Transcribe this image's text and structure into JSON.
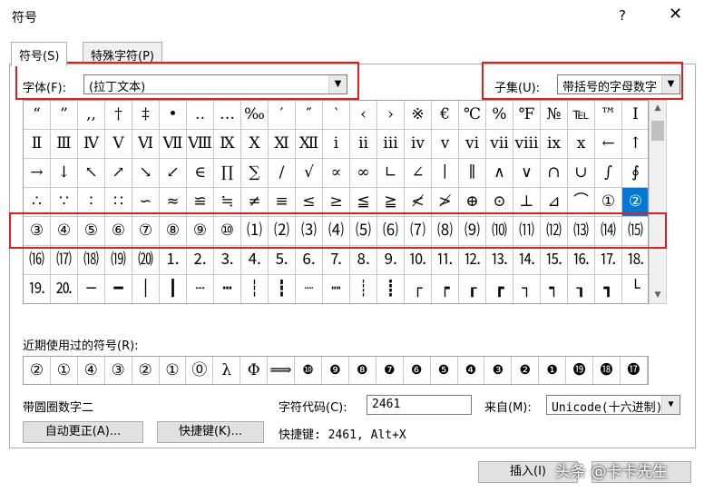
{
  "window": {
    "title": "符号",
    "help": "?",
    "close": "✕"
  },
  "tabs": [
    {
      "label": "符号(S)"
    },
    {
      "label": "特殊字符(P)"
    }
  ],
  "font": {
    "label": "字体(F):",
    "value": "(拉丁文本)"
  },
  "subset": {
    "label": "子集(U):",
    "value": "带括号的字母数字"
  },
  "symbols": [
    "“",
    "”",
    ",,",
    "†",
    "‡",
    "•",
    "‥",
    "…",
    "‰",
    "′",
    "″",
    "‵",
    "‹",
    "›",
    "※",
    "€",
    "℃",
    "%",
    "℉",
    "№",
    "℡",
    "™",
    "Ⅰ",
    "Ⅱ",
    "Ⅲ",
    "Ⅳ",
    "Ⅴ",
    "Ⅵ",
    "Ⅶ",
    "Ⅷ",
    "Ⅸ",
    "Ⅹ",
    "Ⅺ",
    "Ⅻ",
    "ⅰ",
    "ⅱ",
    "ⅲ",
    "ⅳ",
    "ⅴ",
    "ⅵ",
    "ⅶ",
    "ⅷ",
    "ⅸ",
    "ⅹ",
    "←",
    "↑",
    "→",
    "↓",
    "↖",
    "↗",
    "↘",
    "↙",
    "∈",
    "∏",
    "∑",
    "∕",
    "√",
    "∝",
    "∞",
    "∟",
    "∠",
    "∣",
    "∥",
    "∧",
    "∨",
    "∩",
    "∪",
    "∫",
    "∮",
    "∴",
    "∵",
    "∶",
    "∷",
    "∽",
    "≈",
    "≌",
    "≒",
    "≠",
    "≡",
    "≤",
    "≥",
    "≦",
    "≧",
    "≮",
    "≯",
    "⊕",
    "⊙",
    "⊥",
    "⊿",
    "⌒",
    "①",
    "②",
    "③",
    "④",
    "⑤",
    "⑥",
    "⑦",
    "⑧",
    "⑨",
    "⑩",
    "⑴",
    "⑵",
    "⑶",
    "⑷",
    "⑸",
    "⑹",
    "⑺",
    "⑻",
    "⑼",
    "⑽",
    "⑾",
    "⑿",
    "⒀",
    "⒁",
    "⒂",
    "⒃",
    "⒄",
    "⒅",
    "⒆",
    "⒇",
    "⒈",
    "⒉",
    "⒊",
    "⒋",
    "⒌",
    "⒍",
    "⒎",
    "⒏",
    "⒐",
    "⒑",
    "⒒",
    "⒓",
    "⒔",
    "⒕",
    "⒖",
    "⒗",
    "⒘",
    "⒙",
    "⒚",
    "⒛",
    "─",
    "━",
    "│",
    "┃",
    "┄",
    "┅",
    "┆",
    "┇",
    "┈",
    "┉",
    "┊",
    "┋",
    "┌",
    "┍",
    "┎",
    "┏",
    "┐",
    "┑",
    "┒",
    "┓",
    "└"
  ],
  "selected_index": 91,
  "recent": {
    "label": "近期使用过的符号(R):",
    "items": [
      "②",
      "①",
      "④",
      "③",
      "②",
      "①",
      "⓪",
      "λ",
      "Φ",
      "⟹",
      "❿",
      "❾",
      "❽",
      "❼",
      "❻",
      "❺",
      "❹",
      "❸",
      "❷",
      "❶",
      "⓳",
      "⓲",
      "⓱"
    ]
  },
  "char_name": "带圆圈数字二",
  "char_code": {
    "label": "字符代码(C):",
    "value": "2461"
  },
  "from": {
    "label": "来自(M):",
    "value": "Unicode(十六进制)"
  },
  "buttons": {
    "autocorrect": "自动更正(A)...",
    "shortcut": "快捷键(K)...",
    "insert": "插入(I)"
  },
  "shortcut_text": "快捷键: 2461, Alt+X",
  "watermark": "头条 @卡卡先生",
  "colors": {
    "highlight": "#0078d7",
    "annotation": "#e02020"
  }
}
